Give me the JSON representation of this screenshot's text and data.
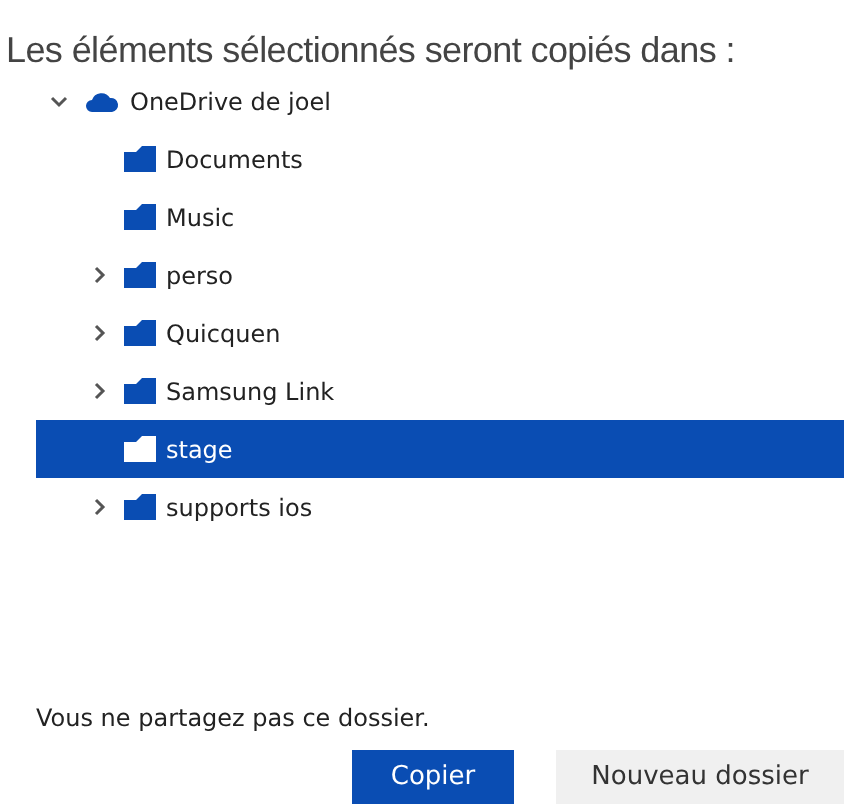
{
  "title": "Les éléments sélectionnés seront copiés dans :",
  "tree": [
    {
      "label": "OneDrive de joel",
      "kind": "drive",
      "expanded": true,
      "selected": false,
      "children": [
        {
          "label": "Documents",
          "kind": "folder",
          "expandable": false,
          "selected": false
        },
        {
          "label": "Music",
          "kind": "folder",
          "expandable": false,
          "selected": false
        },
        {
          "label": "perso",
          "kind": "folder",
          "expandable": true,
          "selected": false
        },
        {
          "label": "Quicquen",
          "kind": "folder",
          "expandable": true,
          "selected": false
        },
        {
          "label": "Samsung Link",
          "kind": "folder",
          "expandable": true,
          "selected": false
        },
        {
          "label": "stage",
          "kind": "folder",
          "expandable": false,
          "selected": true
        },
        {
          "label": "supports ios",
          "kind": "folder",
          "expandable": true,
          "selected": false
        }
      ]
    }
  ],
  "message": "Vous ne partagez pas ce dossier.",
  "buttons": [
    {
      "label": "Copier",
      "kind": "primary"
    },
    {
      "label": "Nouveau dossier",
      "kind": "secondary"
    }
  ]
}
